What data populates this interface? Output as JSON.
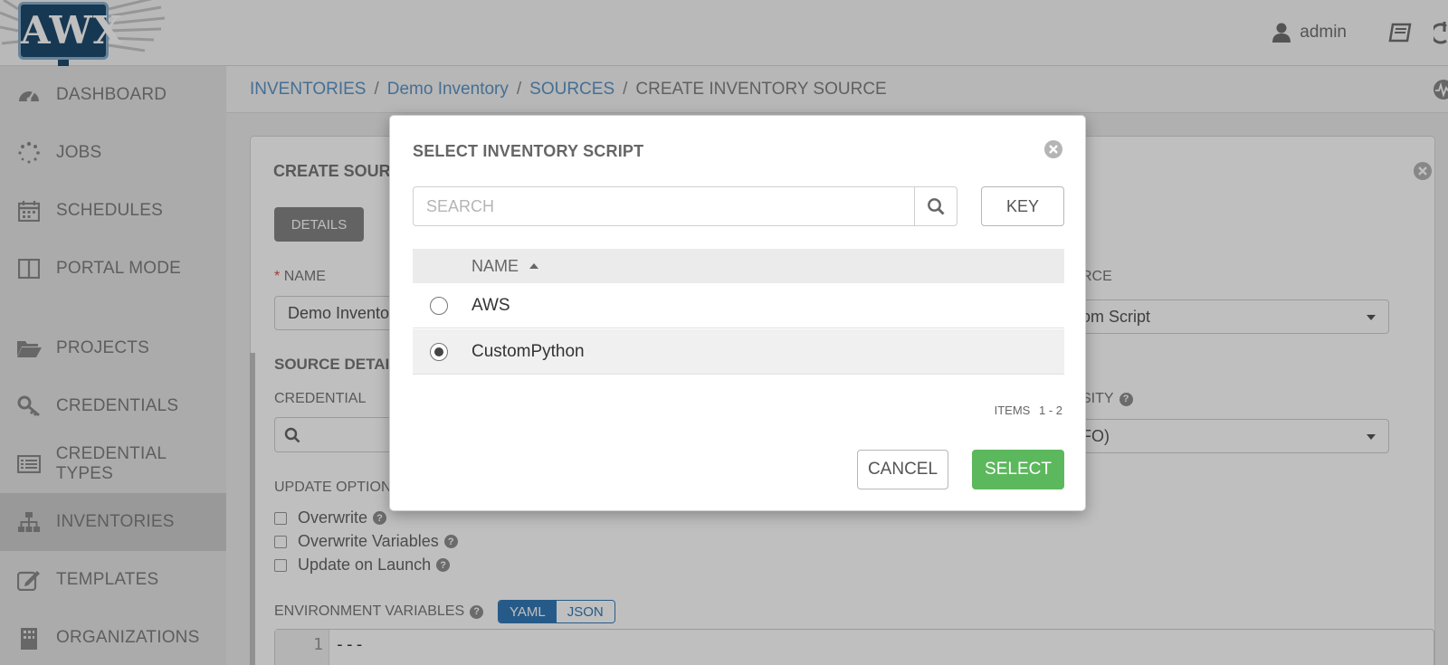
{
  "app": {
    "logo_text": "AWX"
  },
  "topbar": {
    "user_name": "admin"
  },
  "sidebar": {
    "items": [
      {
        "label": "DASHBOARD",
        "icon": "dashboard-icon"
      },
      {
        "label": "JOBS",
        "icon": "jobs-spinner-icon"
      },
      {
        "label": "SCHEDULES",
        "icon": "calendar-icon"
      },
      {
        "label": "PORTAL MODE",
        "icon": "portal-icon"
      },
      {
        "label": "PROJECTS",
        "icon": "folder-icon"
      },
      {
        "label": "CREDENTIALS",
        "icon": "key-icon"
      },
      {
        "label": "CREDENTIAL TYPES",
        "icon": "list-icon"
      },
      {
        "label": "INVENTORIES",
        "icon": "sitemap-icon",
        "active": true
      },
      {
        "label": "TEMPLATES",
        "icon": "edit-icon"
      },
      {
        "label": "ORGANIZATIONS",
        "icon": "building-icon"
      }
    ]
  },
  "breadcrumb": {
    "items": [
      "INVENTORIES",
      "Demo Inventory",
      "SOURCES"
    ],
    "current": "CREATE INVENTORY SOURCE",
    "separator": "/"
  },
  "form": {
    "title": "CREATE SOURC",
    "tab_details": "DETAILS",
    "name_label": "NAME",
    "name_required": "*",
    "name_value": "Demo Invento",
    "source_label": "RCE",
    "source_value": "om Script",
    "source_details_heading": "SOURCE DETAIL",
    "credential_label": "CREDENTIAL",
    "verbosity_label": "SITY",
    "verbosity_value": "FO)",
    "update_options_label": "UPDATE OPTION",
    "options": [
      "Overwrite",
      "Overwrite Variables",
      "Update on Launch"
    ],
    "env_vars_label": "ENVIRONMENT VARIABLES",
    "toggle_yaml": "YAML",
    "toggle_json": "JSON",
    "code_line_number": "1",
    "code_line_text": "---",
    "help_glyph": "?"
  },
  "modal": {
    "title": "SELECT INVENTORY SCRIPT",
    "search_placeholder": "SEARCH",
    "key_label": "KEY",
    "column_name": "NAME",
    "rows": [
      {
        "name": "AWS",
        "selected": false
      },
      {
        "name": "CustomPython",
        "selected": true
      }
    ],
    "items_label": "ITEMS",
    "items_range": "1 - 2",
    "cancel_label": "CANCEL",
    "select_label": "SELECT"
  },
  "colors": {
    "brand_blue": "#1f4b6e",
    "link_blue": "#5d94c4",
    "select_green": "#5cb85c",
    "required_red": "#d9534f"
  }
}
